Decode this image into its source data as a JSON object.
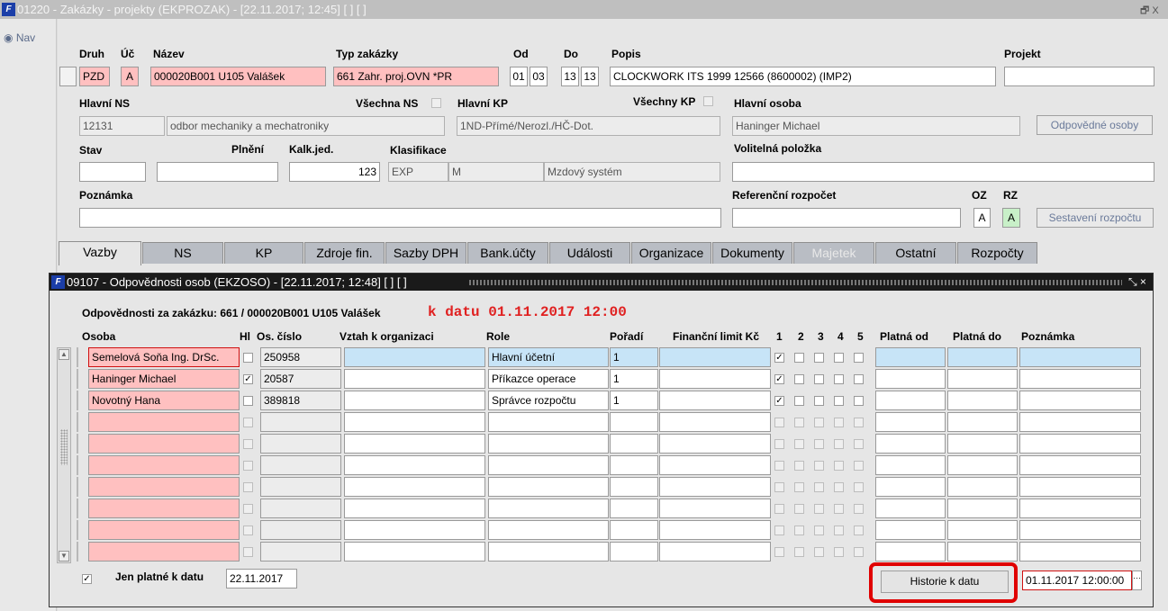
{
  "window": {
    "title": "01220 - Zakázky - projekty (EKPROZAK) - [22.11.2017; 12:45]  [ ]  [ ]",
    "app_icon": "forms-icon",
    "controls_text": "🗗 X"
  },
  "nav": {
    "label": "Nav"
  },
  "form": {
    "labels": {
      "druh": "Druh",
      "uc": "Úč",
      "nazev": "Název",
      "typ": "Typ zakázky",
      "od": "Od",
      "do": "Do",
      "popis": "Popis",
      "projekt": "Projekt",
      "hlavni_ns": "Hlavní NS",
      "vsechna_ns": "Všechna NS",
      "hlavni_kp": "Hlavní KP",
      "vsechny_kp": "Všechny KP",
      "hlavni_osoba": "Hlavní osoba",
      "stav": "Stav",
      "plneni": "Plnění",
      "kalk": "Kalk.jed.",
      "klasifikace": "Klasifikace",
      "volitelna": "Volitelná položka",
      "poznamka": "Poznámka",
      "ref_rozpocet": "Referenční rozpočet",
      "oz": "OZ",
      "rz": "RZ"
    },
    "values": {
      "druh": "PZD",
      "uc": "A",
      "nazev": "000020B001 U105 Valášek",
      "typ": "661 Zahr. proj.OVN *PR",
      "od1": "01",
      "od2": "03",
      "do1": "13",
      "do2": "13",
      "popis": "CLOCKWORK ITS 1999 12566 (8600002) (IMP2)",
      "projekt": "",
      "ns_code": "12131",
      "ns_name": "odbor mechaniky a mechatroniky",
      "kp": "1ND-Přímé/Nerozl./HČ-Dot.",
      "osoba": "Haninger Michael",
      "stav": "",
      "plneni": "",
      "kalk": "123",
      "klas1": "EXP",
      "klas2": "M",
      "klas3": "Mzdový systém",
      "volitelna": "",
      "poznamka": "",
      "ref_rozpocet": "",
      "oz": "A",
      "rz": "A"
    },
    "buttons": {
      "odpovedne": "Odpovědné osoby",
      "sestaveni": "Sestavení rozpočtu"
    }
  },
  "tabs": [
    "Vazby",
    "NS",
    "KP",
    "Zdroje fin.",
    "Sazby DPH",
    "Bank.účty",
    "Události",
    "Organizace",
    "Dokumenty",
    "Majetek",
    "Ostatní",
    "Rozpočty"
  ],
  "dialog": {
    "title": "09107 - Odpovědnosti osob (EKZOSO) - [22.11.2017; 12:48]  [ ]  [ ]",
    "controls_text": "⤡ ×",
    "heading": "Odpovědnosti za zakázku: 661 / 000020B001 U105 Valášek",
    "heading_date": "k datu 01.11.2017 12:00",
    "columns": {
      "osoba": "Osoba",
      "hl": "Hl",
      "cislo": "Os. číslo",
      "vztah": "Vztah k organizaci",
      "role": "Role",
      "poradi": "Pořadí",
      "limit": "Finanční limit Kč",
      "c1": "1",
      "c2": "2",
      "c3": "3",
      "c4": "4",
      "c5": "5",
      "od": "Platná od",
      "do": "Platná do",
      "poznamka": "Poznámka"
    },
    "rows": [
      {
        "osoba": "Semelová Soňa Ing. DrSc.",
        "hl": false,
        "cislo": "250958",
        "vztah": "",
        "role": "Hlavní účetní",
        "poradi": "1",
        "limit": "",
        "flags": [
          true,
          false,
          false,
          false,
          false
        ]
      },
      {
        "osoba": "Haninger Michael",
        "hl": true,
        "cislo": "20587",
        "vztah": "",
        "role": "Příkazce operace",
        "poradi": "1",
        "limit": "",
        "flags": [
          true,
          false,
          false,
          false,
          false
        ]
      },
      {
        "osoba": "Novotný Hana",
        "hl": false,
        "cislo": "389818",
        "vztah": "",
        "role": "Správce rozpočtu",
        "poradi": "1",
        "limit": "",
        "flags": [
          true,
          false,
          false,
          false,
          false
        ]
      }
    ],
    "footer": {
      "jen_platne_checked": true,
      "jen_platne_label": "Jen platné k datu",
      "jen_platne_date": "22.11.2017",
      "historie_button": "Historie k datu",
      "historie_date": "01.11.2017 12:00:00"
    }
  }
}
